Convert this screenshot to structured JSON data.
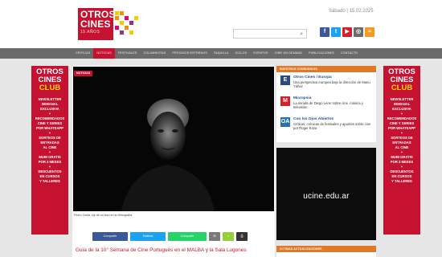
{
  "header": {
    "logo": {
      "line1": "OTROS",
      "line2": "CINES",
      "line3": "15 AÑOS"
    },
    "date": "Sábado | 15.02.2025",
    "search": {
      "placeholder": ""
    },
    "social": [
      {
        "name": "facebook-icon",
        "glyph": "f",
        "color": "#3b5998"
      },
      {
        "name": "twitter-icon",
        "glyph": "t",
        "color": "#1da1f2"
      },
      {
        "name": "youtube-icon",
        "glyph": "▶",
        "color": "#d61f26"
      },
      {
        "name": "instagram-icon",
        "glyph": "◎",
        "color": "#6b6b6b"
      },
      {
        "name": "rss-icon",
        "glyph": "≈",
        "color": "#f59a22"
      }
    ]
  },
  "nav": {
    "items": [
      "CRÍTICAS",
      "NOTICIAS",
      "FESTIVALES",
      "COLUMNISTAS",
      "PRÓXIMOS ESTRENOS",
      "TAQUILLA",
      "CICLOS",
      "EVENTOS",
      "CINE ON DEMAND",
      "PUBLICACIONES",
      "CONTACTO"
    ],
    "active_index": 1
  },
  "club": {
    "title_lines": [
      "OTROS",
      "CINES"
    ],
    "club_word": "CLUB",
    "lines": [
      "NEWSLETTER",
      "SEMANAL",
      "EXCLUSIVA",
      "+",
      "RECOMENDADOS",
      "CINE Y SERIES",
      "POR WHATSAPP",
      "+",
      "SORTEOS DE",
      "ENTRADAS",
      "AL CINE",
      "+",
      "MUBI GRATIS",
      "POR 3 MESES",
      "+",
      "DESCUENTOS",
      "EN CURSOS",
      "Y TALLERES"
    ]
  },
  "article": {
    "section_label": "NOTICIAS",
    "caption": "Pedro Costa, eje de un foco en su filmografía.",
    "share_buttons": [
      {
        "name": "facebook-share-button",
        "label": "Compartir",
        "color": "#3b5998"
      },
      {
        "name": "twitter-share-button",
        "label": "Twittear",
        "color": "#1da1f2"
      },
      {
        "name": "whatsapp-share-button",
        "label": "Compartir",
        "color": "#25d366"
      },
      {
        "name": "email-share-button",
        "label": "✉",
        "color": "#7a7a7a"
      },
      {
        "name": "sharethis-button",
        "label": "<",
        "color": "#95d03a"
      },
      {
        "name": "print-button",
        "label": "⎙",
        "color": "#333333"
      }
    ],
    "headline": "Guía de la 10° Semana de Cine Portugués en el MALBA y la Sala Lugones"
  },
  "sidebar": {
    "sites_title": "NUESTROS CONSUMIDOS",
    "sites": [
      {
        "badge": "E",
        "color": "#2b4a8a",
        "name": "Otros Cines / Europa",
        "desc": "Una perspectiva europea bajo la dirección de Manu Yáñez"
      },
      {
        "badge": "M",
        "color": "#d61f26",
        "name": "Micropsia",
        "desc": "La mirada de Diego Lerer sobre cine, música y televisión"
      },
      {
        "badge": "OA",
        "color": "#2a6fb0",
        "name": "Con los Ojos Abiertos",
        "desc": "Críticas, crónicas de festivales y apuntes sobre cine por Roger Koza"
      }
    ],
    "ad_text": "ucine.edu.ar",
    "latest_title": "ULTIMAS ACTUALIZACIONES"
  }
}
